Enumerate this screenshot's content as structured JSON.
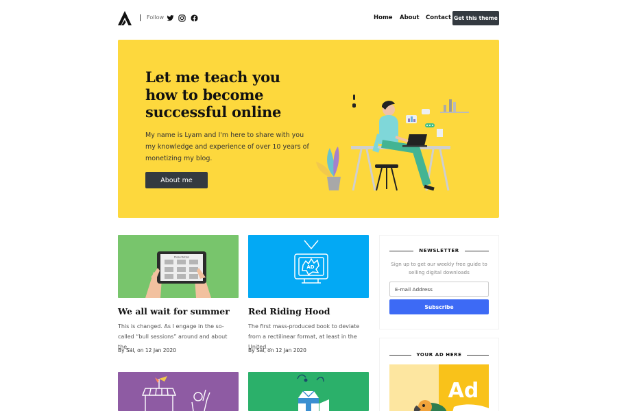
{
  "header": {
    "follow_label": "Follow",
    "social_icons": [
      "twitter-icon",
      "instagram-icon",
      "facebook-icon"
    ],
    "nav": [
      "Home",
      "About",
      "Contact"
    ],
    "cta_label": "Get this theme"
  },
  "hero": {
    "title": "Let me teach you how to become successful online",
    "text": "My name is Lyam and I'm here to share with you my knowledge and experience of over 10 years of monetizing my blog.",
    "button_label": "About me",
    "background_color": "#fdd83d"
  },
  "posts": [
    {
      "title": "We all wait for summer",
      "excerpt": "This is changed. As I engage in the so-called “bull sessions” around and about the...",
      "meta": "By Sal, on 12 Jan 2020",
      "image_label": "Presentation",
      "image_color": "#78c56c"
    },
    {
      "title": "Red Riding Hood",
      "excerpt": "The first mass-produced book to deviate from a rectilinear format, at least in the United...",
      "meta": "By Sal, on 12 Jan 2020",
      "image_label": "AD",
      "image_color": "#03a9f4"
    },
    {
      "image_color": "#8e5ba3"
    },
    {
      "image_color": "#2bb06a"
    }
  ],
  "sidebar": {
    "newsletter": {
      "heading": "NEWSLETTER",
      "text": "Sign up to get our weekly free guide to selling digital downloads",
      "email_placeholder": "E-mail Address",
      "button_label": "Subscribe"
    },
    "ad": {
      "heading": "YOUR AD HERE",
      "image_text": "Ad"
    }
  },
  "colors": {
    "dark_button": "#343a40",
    "subscribe_button": "#3d6af5"
  }
}
